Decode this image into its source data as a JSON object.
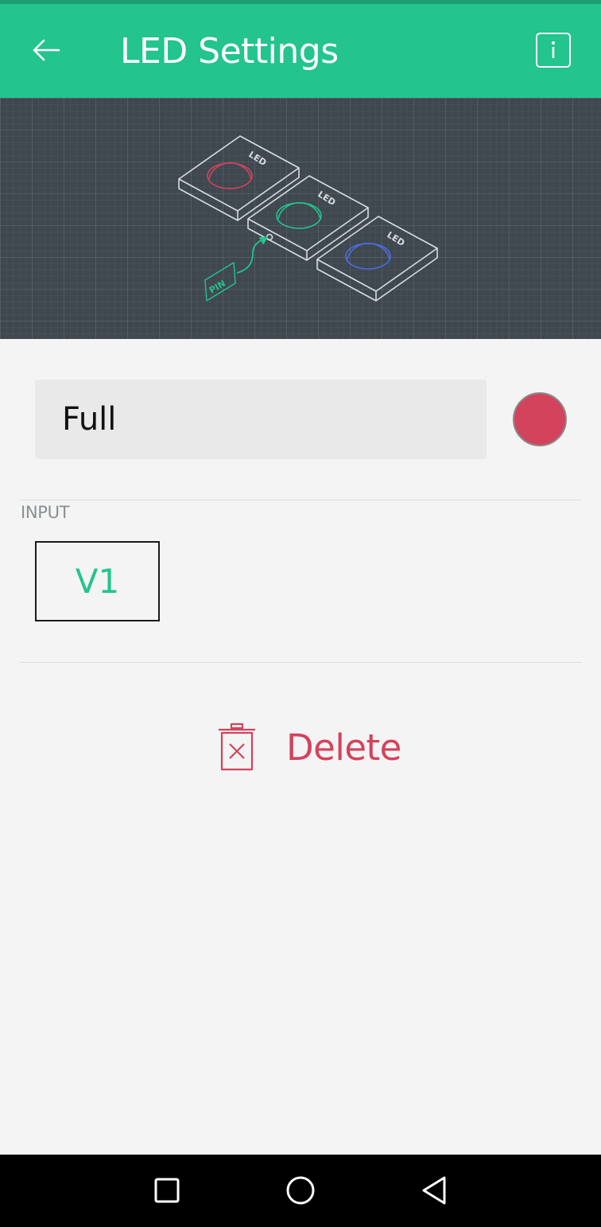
{
  "app_bar": {
    "title": "LED Settings",
    "back_icon": "arrow-left-icon",
    "info_icon": "info-icon",
    "background_color": "#23c48e"
  },
  "hero": {
    "led_label": "LED",
    "pin_label": "PIN",
    "led_colors": [
      "#d3435c",
      "#23c48e",
      "#4a6ee0"
    ]
  },
  "widget": {
    "name_value": "Full",
    "color": "#d3435c"
  },
  "input_section": {
    "label": "INPUT",
    "pin_value": "V1"
  },
  "delete": {
    "label": "Delete",
    "icon": "trash-icon"
  },
  "nav_bar": {
    "items": [
      "recents-square-icon",
      "home-circle-icon",
      "back-triangle-icon"
    ]
  }
}
